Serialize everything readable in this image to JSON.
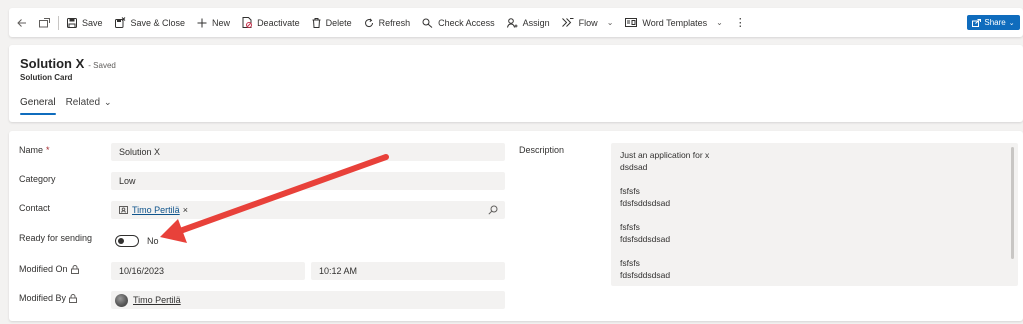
{
  "toolbar": {
    "save": "Save",
    "save_close": "Save & Close",
    "new": "New",
    "deactivate": "Deactivate",
    "delete": "Delete",
    "refresh": "Refresh",
    "check_access": "Check Access",
    "assign": "Assign",
    "flow": "Flow",
    "word_templates": "Word Templates",
    "share": "Share"
  },
  "header": {
    "title": "Solution X",
    "saved_status": "- Saved",
    "subtitle": "Solution Card",
    "tabs": [
      {
        "label": "General",
        "active": true
      },
      {
        "label": "Related",
        "active": false
      }
    ]
  },
  "form": {
    "name": {
      "label": "Name",
      "required_mark": "*",
      "value": "Solution X"
    },
    "category": {
      "label": "Category",
      "value": "Low"
    },
    "contact": {
      "label": "Contact",
      "value": "Timo Pertilä"
    },
    "ready": {
      "label": "Ready for sending",
      "value": "No"
    },
    "modified_on": {
      "label": "Modified On",
      "date": "10/16/2023",
      "time": "10:12 AM"
    },
    "modified_by": {
      "label": "Modified By",
      "value": "Timo Pertilä"
    },
    "description": {
      "label": "Description",
      "lines": [
        "Just an application for x",
        "dsdsad",
        "",
        "fsfsfs",
        "fdsfsddsdsad",
        "",
        "fsfsfs",
        "fdsfsddsdsad",
        "",
        "fsfsfs",
        "fdsfsddsdsad"
      ]
    }
  },
  "colors": {
    "accent": "#0f6cbd",
    "annotation_arrow": "#e8413a",
    "field_bg": "#f3f2f1"
  }
}
